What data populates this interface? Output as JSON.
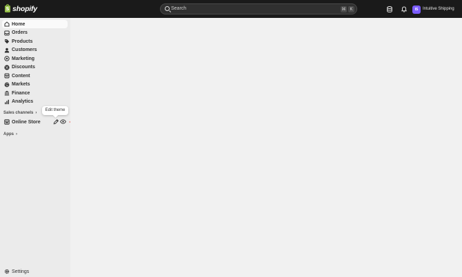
{
  "brand": {
    "name": "shopify"
  },
  "search": {
    "placeholder": "Search",
    "shortcut_cmd": "⌘",
    "shortcut_key": "K"
  },
  "store": {
    "initials": "IS",
    "name": "Intuitive Shipping"
  },
  "nav": [
    {
      "label": "Home",
      "icon": "home-icon",
      "active": true
    },
    {
      "label": "Orders",
      "icon": "inbox-icon"
    },
    {
      "label": "Products",
      "icon": "tag-icon"
    },
    {
      "label": "Customers",
      "icon": "person-icon"
    },
    {
      "label": "Marketing",
      "icon": "target-icon"
    },
    {
      "label": "Discounts",
      "icon": "discount-icon"
    },
    {
      "label": "Content",
      "icon": "content-icon"
    },
    {
      "label": "Markets",
      "icon": "globe-icon"
    },
    {
      "label": "Finance",
      "icon": "bank-icon"
    },
    {
      "label": "Analytics",
      "icon": "chart-icon"
    }
  ],
  "sales_channels": {
    "label": "Sales channels",
    "online_store": "Online Store",
    "tooltip": "Edit theme"
  },
  "apps": {
    "label": "Apps"
  },
  "settings": {
    "label": "Settings"
  },
  "colors": {
    "topbar": "#1a1a1a",
    "sidebar": "#ebebeb",
    "main": "#f1f1f1",
    "arrow": "#e8261c",
    "avatar": "#7b5cff"
  }
}
